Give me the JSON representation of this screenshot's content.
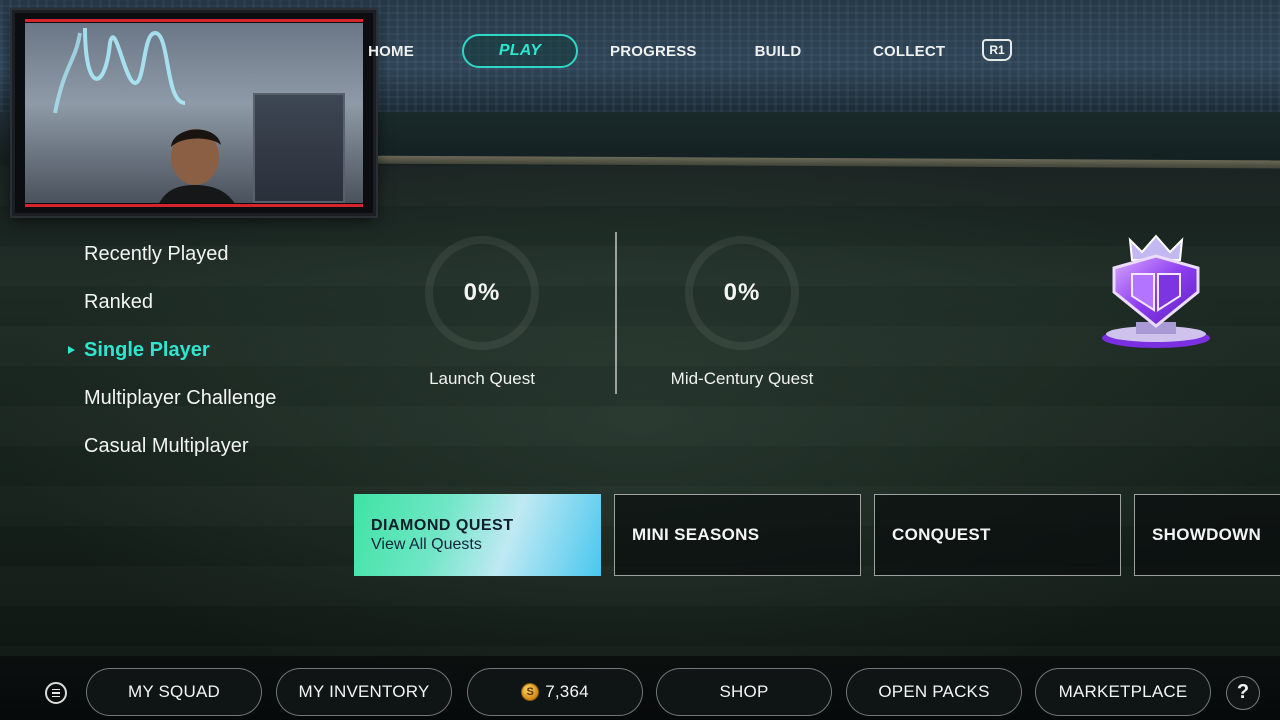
{
  "top_nav": {
    "items": [
      {
        "label": "HOME"
      },
      {
        "label": "PLAY",
        "active": true
      },
      {
        "label": "PROGRESS"
      },
      {
        "label": "BUILD"
      },
      {
        "label": "COLLECT"
      }
    ],
    "r1_label": "R1"
  },
  "side_menu": {
    "items": [
      {
        "label": "Recently Played"
      },
      {
        "label": "Ranked"
      },
      {
        "label": "Single Player",
        "active": true
      },
      {
        "label": "Multiplayer Challenge"
      },
      {
        "label": "Casual Multiplayer"
      }
    ]
  },
  "quests": [
    {
      "percent": "0%",
      "name": "Launch Quest"
    },
    {
      "percent": "0%",
      "name": "Mid-Century Quest"
    }
  ],
  "mode_cards": [
    {
      "title": "DIAMOND QUEST",
      "subtitle": "View All Quests"
    },
    {
      "title": "MINI SEASONS"
    },
    {
      "title": "CONQUEST"
    },
    {
      "title": "SHOWDOWN"
    }
  ],
  "bottom_bar": {
    "my_squad": "MY SQUAD",
    "my_inventory": "MY INVENTORY",
    "coins": "7,364",
    "coin_symbol": "S",
    "shop": "SHOP",
    "open_packs": "OPEN PACKS",
    "marketplace": "MARKETPLACE",
    "help": "?"
  },
  "colors": {
    "accent": "#2ee6cf",
    "webcam_frame_stripe": "#d8242c"
  }
}
